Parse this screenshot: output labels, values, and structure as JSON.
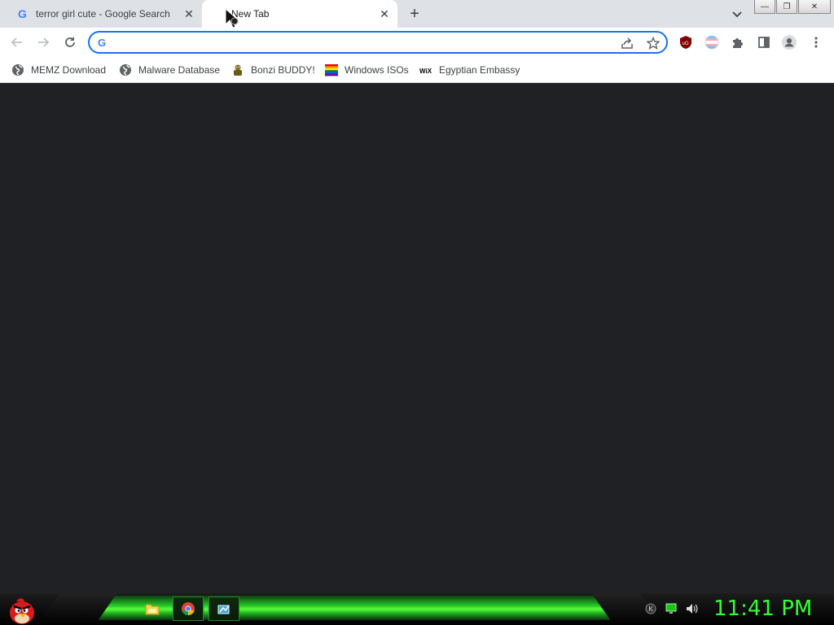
{
  "tabs": [
    {
      "title": "terror girl cute - Google Search",
      "favicon": "google-g-icon",
      "close": "✕"
    },
    {
      "title": "New Tab",
      "close": "✕"
    }
  ],
  "new_tab_label": "+",
  "window_controls": {
    "minimize": "—",
    "maximize": "❐",
    "close": "✕"
  },
  "omnibox": {
    "value": "",
    "placeholder": ""
  },
  "bookmarks": [
    {
      "label": "MEMZ Download",
      "icon": "globe-icon"
    },
    {
      "label": "Malware Database",
      "icon": "globe-icon"
    },
    {
      "label": "Bonzi BUDDY!",
      "icon": "bonzi-icon"
    },
    {
      "label": "Windows ISOs",
      "icon": "rainbow-flag-icon"
    },
    {
      "label": "Egyptian Embassy",
      "icon": "wix-icon"
    }
  ],
  "taskbar": {
    "clock": "11:41 PM"
  },
  "colors": {
    "accent": "#1a73e8",
    "clock": "#33ff33",
    "content_bg": "#202124",
    "taskbar_green": "#25c428"
  }
}
